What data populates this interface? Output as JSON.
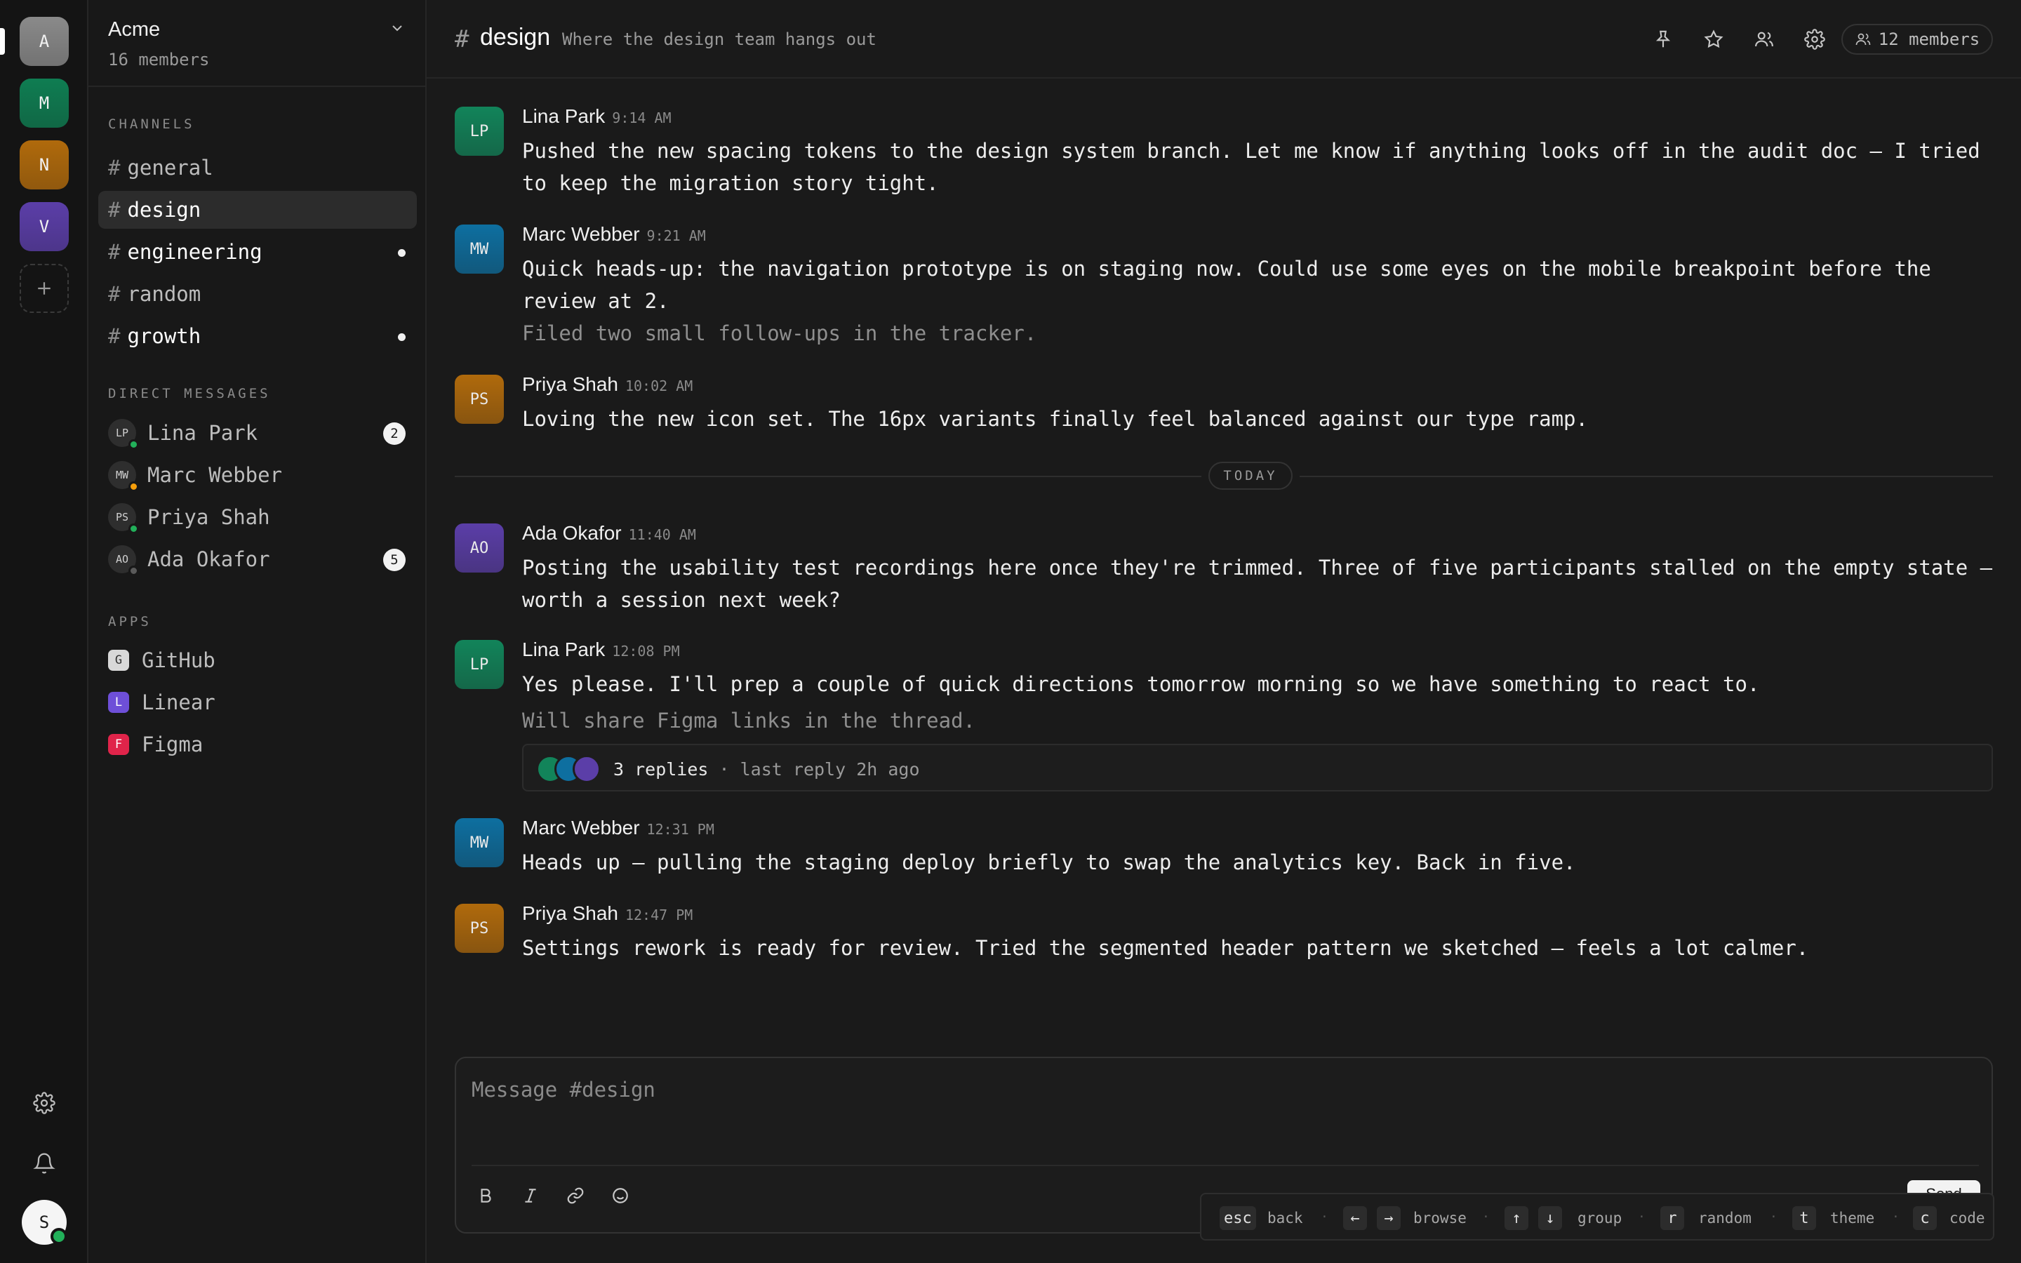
{
  "workspaces": [
    {
      "letter": "A",
      "color": "#8a8a8a"
    },
    {
      "letter": "M",
      "color": "#0f7d52"
    },
    {
      "letter": "N",
      "color": "#b06a0c"
    },
    {
      "letter": "V",
      "color": "#5b3ea8"
    }
  ],
  "workspace": {
    "name": "Acme",
    "members": "16 members"
  },
  "sidebar": {
    "channels_title": "CHANNELS",
    "channels": [
      {
        "name": "general",
        "active": false,
        "unread": false
      },
      {
        "name": "design",
        "active": true,
        "unread": false
      },
      {
        "name": "engineering",
        "active": false,
        "unread": true
      },
      {
        "name": "random",
        "active": false,
        "unread": false
      },
      {
        "name": "growth",
        "active": false,
        "unread": true
      }
    ],
    "dm_title": "DIRECT MESSAGES",
    "dms": [
      {
        "initials": "LP",
        "name": "Lina Park",
        "status": "#22b05a",
        "badge": "2"
      },
      {
        "initials": "MW",
        "name": "Marc Webber",
        "status": "#f59e0b",
        "badge": ""
      },
      {
        "initials": "PS",
        "name": "Priya Shah",
        "status": "#22b05a",
        "badge": ""
      },
      {
        "initials": "AO",
        "name": "Ada Okafor",
        "status": "#5a5a5a",
        "badge": "5"
      }
    ],
    "apps_title": "APPS",
    "apps": [
      {
        "letter": "G",
        "name": "GitHub",
        "color": "#d8d8d8"
      },
      {
        "letter": "L",
        "name": "Linear",
        "color": "#6e4fd8"
      },
      {
        "letter": "F",
        "name": "Figma",
        "color": "#e0244a"
      }
    ]
  },
  "header": {
    "hash": "#",
    "channel": "design",
    "description": "Where the design team hangs out",
    "members_label": "12 members"
  },
  "messages": [
    {
      "initials": "LP",
      "author": "Lina Park",
      "time": "9:14 AM",
      "color": "#12845a",
      "text": "Pushed the new spacing tokens to the design system branch. Let me know if anything looks off in the audit doc — I tried to keep the migration story tight.",
      "followup": ""
    },
    {
      "initials": "MW",
      "author": "Marc Webber",
      "time": "9:21 AM",
      "color": "#0e6fa0",
      "text": "Quick heads-up: the navigation prototype is on staging now. Could use some eyes on the mobile breakpoint before the review at 2.",
      "followup": "Filed two small follow-ups in the tracker."
    },
    {
      "initials": "PS",
      "author": "Priya Shah",
      "time": "10:02 AM",
      "color": "#b06a0c",
      "text": "Loving the new icon set. The 16px variants finally feel balanced against our type ramp.",
      "followup": ""
    },
    {
      "initials": "AO",
      "author": "Ada Okafor",
      "time": "11:40 AM",
      "color": "#5b3ea8",
      "text": "Posting the usability test recordings here once they're trimmed. Three of five participants stalled on the empty state — worth a session next week?",
      "followup": ""
    },
    {
      "initials": "LP",
      "author": "Lina Park",
      "time": "12:08 PM",
      "color": "#12845a",
      "text": "Yes please. I'll prep a couple of quick directions tomorrow morning so we have something to react to.",
      "followup": "Will share Figma links in the thread."
    },
    {
      "initials": "MW",
      "author": "Marc Webber",
      "time": "12:31 PM",
      "color": "#0e6fa0",
      "text": "Heads up — pulling the staging deploy briefly to swap the analytics key. Back in five.",
      "followup": ""
    },
    {
      "initials": "PS",
      "author": "Priya Shah",
      "time": "12:47 PM",
      "color": "#b06a0c",
      "text": "Settings rework is ready for review. Tried the segmented header pattern we sketched — feels a lot calmer.",
      "followup": ""
    }
  ],
  "divider_label": "TODAY",
  "thread": {
    "replies": "3 replies",
    "last": "· last reply 2h ago",
    "avatar_colors": [
      "#12845a",
      "#0e6fa0",
      "#5b3ea8"
    ]
  },
  "composer": {
    "placeholder": "Message #design",
    "send_label": "Send"
  },
  "hints": [
    {
      "keys": [
        "esc"
      ],
      "label": "back"
    },
    {
      "keys": [
        "←",
        "→"
      ],
      "label": "browse"
    },
    {
      "keys": [
        "↑",
        "↓"
      ],
      "label": "group"
    },
    {
      "keys": [
        "r"
      ],
      "label": "random"
    },
    {
      "keys": [
        "t"
      ],
      "label": "theme"
    },
    {
      "keys": [
        "c"
      ],
      "label": "code"
    }
  ],
  "user": {
    "initial": "S"
  }
}
